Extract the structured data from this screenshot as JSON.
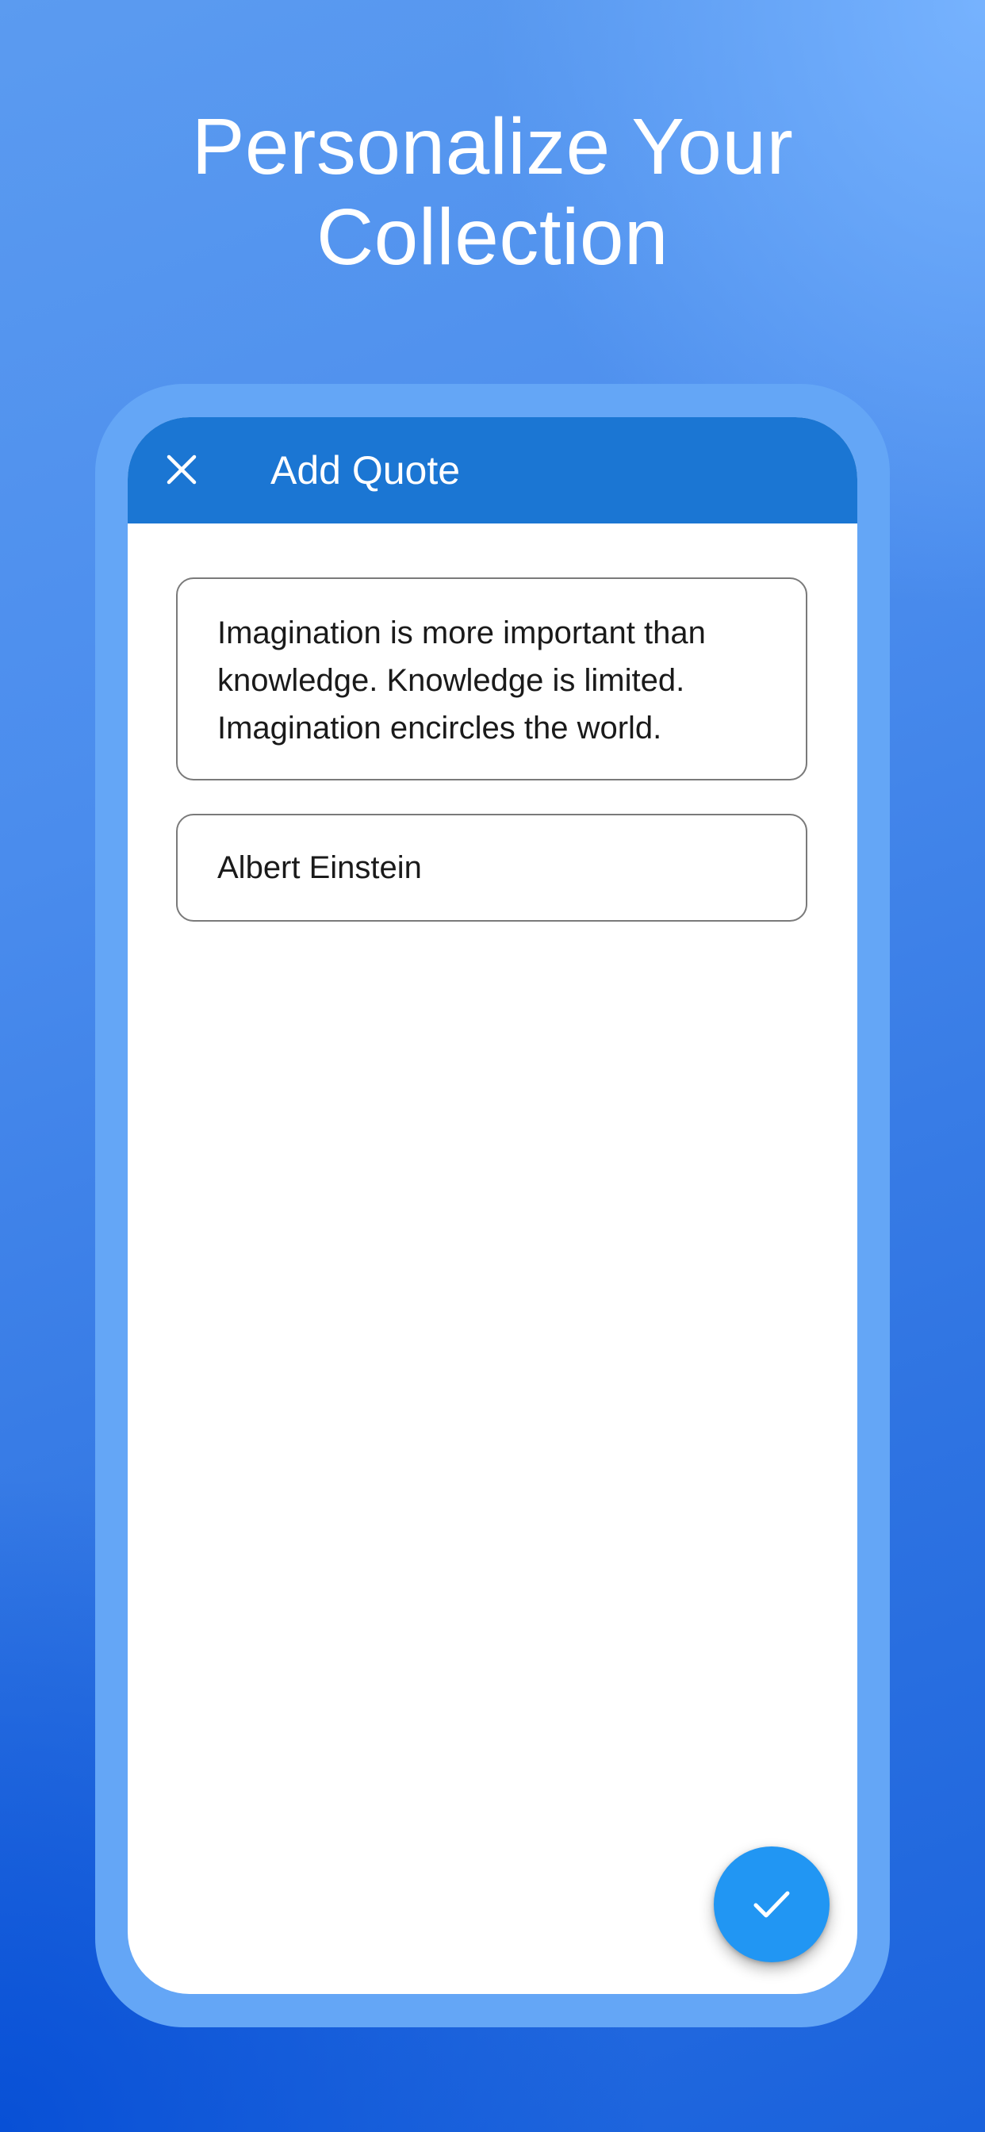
{
  "promo": {
    "headline_line1": "Personalize Your",
    "headline_line2": "Collection"
  },
  "appbar": {
    "title": "Add Quote",
    "close_icon": "close-icon"
  },
  "form": {
    "quote_value": "Imagination is more important than knowledge. Knowledge is limited. Imagination encircles the world.",
    "author_value": "Albert Einstein"
  },
  "fab": {
    "icon": "check-icon"
  },
  "colors": {
    "appbar": "#1b76d3",
    "fab": "#2196f3",
    "frame": "#64a6f6",
    "background": "#3f86ea"
  }
}
